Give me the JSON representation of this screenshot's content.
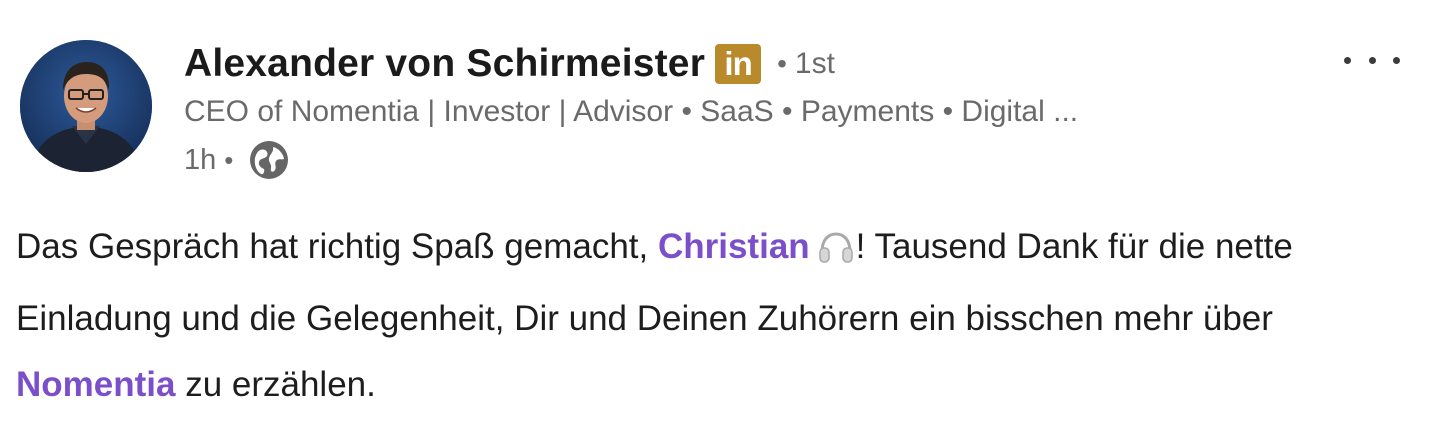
{
  "author": {
    "name": "Alexander von Schirmeister",
    "linkedin_badge": "in",
    "degree": "1st",
    "separator": "•",
    "headline": "CEO of Nomentia | Investor | Advisor • SaaS • Payments • Digital ...",
    "time": "1h",
    "time_separator": "•",
    "visibility_icon": "globe-icon"
  },
  "menu": {
    "icon": "more-options-icon"
  },
  "post": {
    "line1_a": "Das Gespräch hat richtig Spaß gemacht, ",
    "mention1": "Christian",
    "line1_b": "! Tausend Dank für die nette Einladung und die Gelegenheit, Dir und Deinen Zuhörern ein bisschen mehr über ",
    "mention2": "Nomentia",
    "line1_c": " zu erzählen.",
    "emoji": "headphone-icon"
  },
  "colors": {
    "mention": "#7b4fc9",
    "badge": "#b98a2c",
    "secondary_text": "#6a6a6a"
  }
}
